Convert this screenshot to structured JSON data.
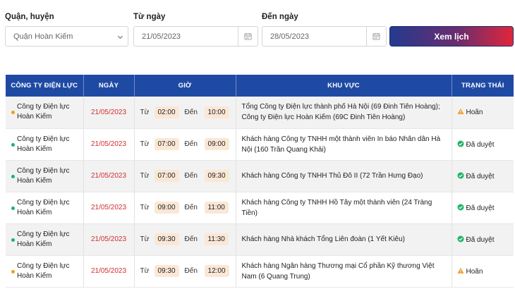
{
  "filters": {
    "district_label": "Quận, huyện",
    "district_value": "Quận Hoàn Kiếm",
    "from_label": "Từ ngày",
    "from_value": "21/05/2023",
    "to_label": "Đến ngày",
    "to_value": "28/05/2023",
    "view_button": "Xem lịch",
    "icons": {
      "dropdown": "chevron-down-icon",
      "calendar": "calendar-icon"
    }
  },
  "table": {
    "headers": [
      "CÔNG TY ĐIỆN LỰC",
      "NGÀY",
      "GIỜ",
      "KHU VỰC",
      "TRẠNG THÁI"
    ],
    "time_from_word": "Từ",
    "time_to_word": "Đến",
    "colors": {
      "header_bg": "#1f4aa4",
      "date_text": "#d0302e",
      "pending": "#f29a1b",
      "approved": "#1db36a",
      "pill": "#fbe7d6"
    },
    "rows": [
      {
        "company_line1": "Công ty Điện lực",
        "company_line2": "Hoàn Kiếm",
        "date": "21/05/2023",
        "from": "02:00",
        "to": "10:00",
        "area": "Tổng Công ty Điện lực thành phố Hà Nội (69 Đinh Tiên Hoàng); Công ty Điện lực Hoàn Kiếm (69C Đinh Tiên Hoàng)",
        "status": "Hoãn",
        "status_type": "pending",
        "status_icon": "warning-icon"
      },
      {
        "company_line1": "Công ty Điện lực",
        "company_line2": "Hoàn Kiếm",
        "date": "21/05/2023",
        "from": "07:00",
        "to": "09:00",
        "area": "Khách hàng Công ty TNHH một thành viên In báo Nhân dân Hà Nội (160 Trần Quang Khải)",
        "status": "Đã duyệt",
        "status_type": "approved",
        "status_icon": "check-circle-icon"
      },
      {
        "company_line1": "Công ty Điện lực",
        "company_line2": "Hoàn Kiếm",
        "date": "21/05/2023",
        "from": "07:00",
        "to": "09:30",
        "area": "Khách hàng Công ty TNHH Thủ Đô II (72 Trần Hưng Đạo)",
        "status": "Đã duyệt",
        "status_type": "approved",
        "status_icon": "check-circle-icon"
      },
      {
        "company_line1": "Công ty Điện lực",
        "company_line2": "Hoàn Kiếm",
        "date": "21/05/2023",
        "from": "09:00",
        "to": "11:00",
        "area": "Khách hàng Công ty TNHH Hồ Tây một thành viên (24 Tràng Tiền)",
        "status": "Đã duyệt",
        "status_type": "approved",
        "status_icon": "check-circle-icon"
      },
      {
        "company_line1": "Công ty Điện lực",
        "company_line2": "Hoàn Kiếm",
        "date": "21/05/2023",
        "from": "09:30",
        "to": "11:30",
        "area": "Khách hàng Nhà khách Tổng Liên đoàn (1 Yết Kiêu)",
        "status": "Đã duyệt",
        "status_type": "approved",
        "status_icon": "check-circle-icon"
      },
      {
        "company_line1": "Công ty Điện lực",
        "company_line2": "Hoàn Kiếm",
        "date": "21/05/2023",
        "from": "09:30",
        "to": "12:00",
        "area": "Khách hàng Ngân hàng Thương mại Cổ phần Kỹ thương Việt Nam (6 Quang Trung)",
        "status": "Hoãn",
        "status_type": "pending",
        "status_icon": "warning-icon"
      }
    ]
  }
}
